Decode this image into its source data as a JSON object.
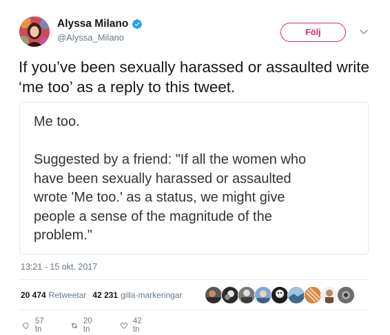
{
  "user": {
    "display_name": "Alyssa Milano",
    "handle": "@Alyssa_Milano",
    "verified_icon": "verified-badge-icon",
    "avatar_color": "#cc3b4d"
  },
  "follow": {
    "label": "Följ",
    "color": "#e0245e"
  },
  "tweet": {
    "text": "If you’ve been sexually harassed or assaulted write ‘me too’ as a reply to this tweet."
  },
  "media": {
    "lines": [
      "Me too.",
      "Suggested by a friend: \"If all the women who",
      "have been sexually harassed or assaulted",
      "wrote 'Me too.' as a status, we might give",
      "people a sense of the magnitude of the",
      "problem.\""
    ]
  },
  "timestamp": "13:21 - 15 okt. 2017",
  "stats": {
    "retweets_count": "20 474",
    "retweets_label": "Retweetar",
    "likes_count": "42 231",
    "likes_label": "gilla-markeringar"
  },
  "actions": {
    "reply_count": "57 tn",
    "retweet_count": "20 tn",
    "like_count": "42 tn"
  },
  "colors": {
    "text": "#14171a",
    "secondary": "#657786",
    "verified": "#1da1f2",
    "border": "#e1e8ed"
  }
}
